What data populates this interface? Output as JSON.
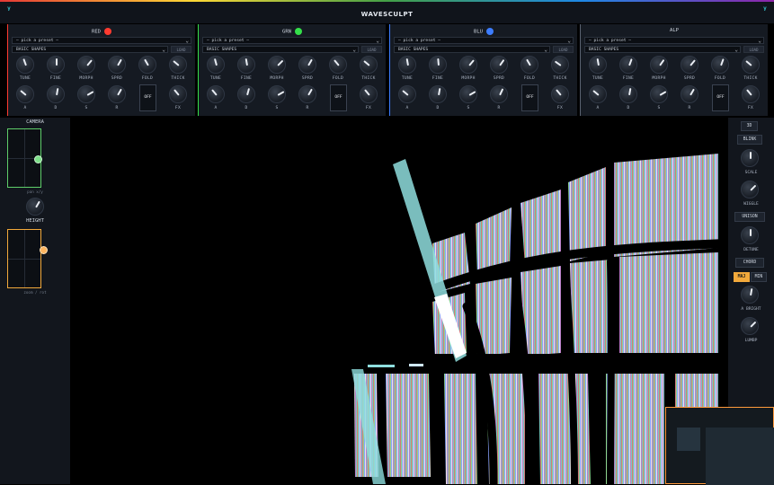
{
  "app": {
    "title": "WAVESCULPT",
    "logo_glyph": "ᵞ"
  },
  "channels": [
    {
      "name": "RED",
      "color": "#ff3b30",
      "preset_placeholder": "— pick a preset —",
      "bank": "BASIC SHAPES",
      "load": "LOAD",
      "knobs_top": [
        "TUNE",
        "FINE",
        "MORPH",
        "SPRD",
        "FOLD",
        "THICK"
      ],
      "knobs_bottom": [
        "A",
        "D",
        "S",
        "R",
        "",
        "FX"
      ],
      "off": "OFF"
    },
    {
      "name": "GRN",
      "color": "#34e04a",
      "preset_placeholder": "— pick a preset —",
      "bank": "BASIC SHAPES",
      "load": "LOAD",
      "knobs_top": [
        "TUNE",
        "FINE",
        "MORPH",
        "SPRD",
        "FOLD",
        "THICK"
      ],
      "knobs_bottom": [
        "A",
        "D",
        "S",
        "R",
        "",
        "FX"
      ],
      "off": "OFF"
    },
    {
      "name": "BLU",
      "color": "#3d7dff",
      "preset_placeholder": "— pick a preset —",
      "bank": "BASIC SHAPES",
      "load": "LOAD",
      "knobs_top": [
        "TUNE",
        "FINE",
        "MORPH",
        "SPRD",
        "FOLD",
        "THICK"
      ],
      "knobs_bottom": [
        "A",
        "D",
        "S",
        "R",
        "",
        "FX"
      ],
      "off": "OFF"
    },
    {
      "name": "ALP",
      "color": "",
      "preset_placeholder": "— pick a preset —",
      "bank": "BASIC SHAPES",
      "load": "LOAD",
      "knobs_top": [
        "TUNE",
        "FINE",
        "MORPH",
        "SPRD",
        "FOLD",
        "THICK"
      ],
      "knobs_bottom": [
        "A",
        "D",
        "S",
        "R",
        "",
        "FX"
      ],
      "off": "OFF"
    }
  ],
  "camera": {
    "title": "CAMERA",
    "pan_caption": "pan x/y",
    "height_label": "HEIGHT",
    "orbit_caption": "zoom / rot"
  },
  "right": {
    "mode_3d": "3D",
    "blink": "BLINK",
    "scale": "SCALE",
    "wiggle": "WIGGLE",
    "unison": "UNISON",
    "detune": "DETUNE",
    "chord": "CHORD",
    "maj": "MAJ",
    "min": "MIN",
    "a_bright": "A BRIGHT",
    "lumbp": "LUMBP"
  },
  "colors": {
    "accent": "#f2a93b",
    "red": "#ff3b30",
    "green": "#34e04a",
    "blue": "#3d7dff"
  }
}
